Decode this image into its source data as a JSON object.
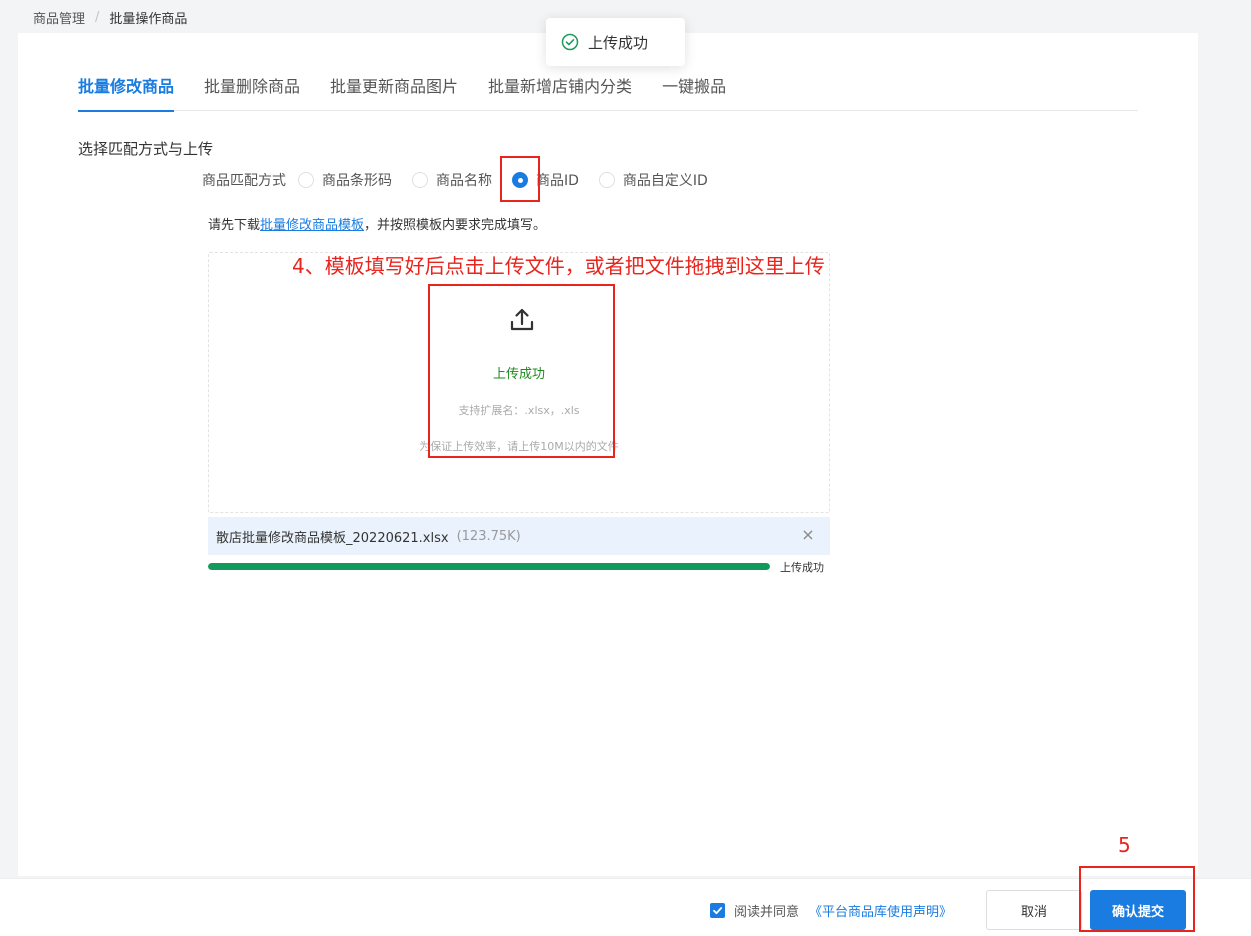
{
  "breadcrumb": {
    "items": [
      "商品管理",
      "批量操作商品"
    ],
    "separator": "/"
  },
  "toast": {
    "message": "上传成功",
    "icon": "check-circle-icon",
    "color": "#1e9a5c"
  },
  "tabs": [
    {
      "label": "批量修改商品",
      "active": true
    },
    {
      "label": "批量删除商品",
      "active": false
    },
    {
      "label": "批量更新商品图片",
      "active": false
    },
    {
      "label": "批量新增店铺内分类",
      "active": false
    },
    {
      "label": "一键搬品",
      "active": false
    }
  ],
  "section_title": "选择匹配方式与上传",
  "match": {
    "label": "商品匹配方式",
    "options": [
      {
        "label": "商品条形码",
        "checked": false
      },
      {
        "label": "商品名称",
        "checked": false
      },
      {
        "label": "商品ID",
        "checked": true
      },
      {
        "label": "商品自定义ID",
        "checked": false
      }
    ]
  },
  "download_tip": {
    "prefix": "请先下载",
    "link": "批量修改商品模板",
    "suffix": "，并按照模板内要求完成填写。"
  },
  "annotations": {
    "step4": "4、模板填写好后点击上传文件，或者把文件拖拽到这里上传",
    "step5": "5"
  },
  "upload": {
    "icon": "upload-icon",
    "status": "上传成功",
    "extensions": "支持扩展名：.xlsx，.xls",
    "limit": "为保证上传效率，请上传10M以内的文件"
  },
  "file": {
    "name": "散店批量修改商品模板_20220621.xlsx",
    "size": "(123.75K)",
    "progress": 1.0,
    "progress_label": "上传成功"
  },
  "footer": {
    "agree_checked": true,
    "agree_label": "阅读并同意",
    "agree_link": "《平台商品库使用声明》",
    "cancel_label": "取消",
    "submit_label": "确认提交"
  },
  "colors": {
    "primary": "#1a7ce0",
    "annotation": "#e8241c",
    "success": "#1e8a1e",
    "progress": "#129a5c"
  }
}
